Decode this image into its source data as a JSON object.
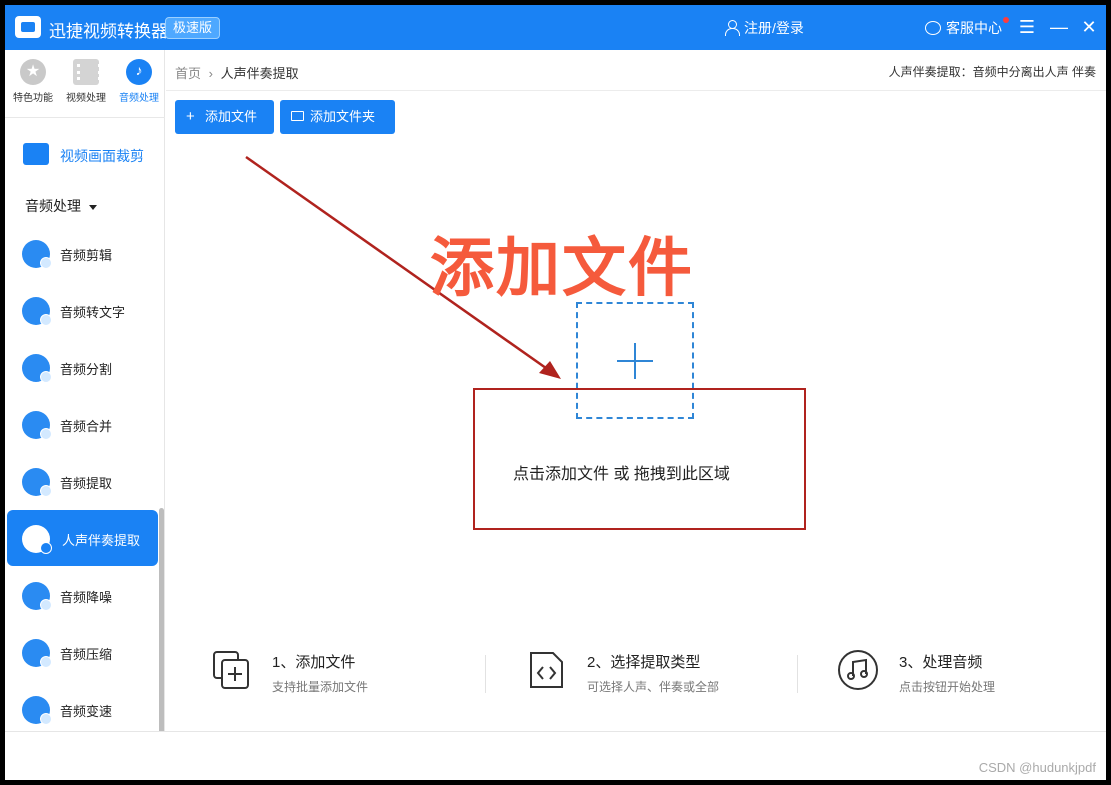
{
  "window": {
    "app_title": "迅捷视频转换器",
    "badge": "极速版",
    "login": "注册/登录",
    "service": "客服中心",
    "menu_glyph": "☰",
    "minimize_glyph": "—",
    "close_glyph": "✕"
  },
  "sidebar": {
    "tabs": [
      {
        "label": "特色功能",
        "icon": "star-icon"
      },
      {
        "label": "视频处理",
        "icon": "film-icon"
      },
      {
        "label": "音频处理",
        "icon": "audio-icon",
        "active": true
      }
    ],
    "crop_item": "视频画面裁剪",
    "section": "音频处理",
    "items": [
      {
        "label": "音频剪辑"
      },
      {
        "label": "音频转文字"
      },
      {
        "label": "音频分割"
      },
      {
        "label": "音频合并"
      },
      {
        "label": "音频提取"
      },
      {
        "label": "人声伴奏提取",
        "active": true
      },
      {
        "label": "音频降噪"
      },
      {
        "label": "音频压缩"
      },
      {
        "label": "音频变速"
      }
    ]
  },
  "breadcrumb": {
    "home": "首页",
    "separator": "›",
    "current": "人声伴奏提取"
  },
  "tip": "人声伴奏提取：音频中分离出人声 伴奏",
  "toolbar": {
    "add_file": "添加文件",
    "add_folder": "添加文件夹",
    "plus_glyph": "+"
  },
  "annotation": {
    "text": "添加文件",
    "color": "#f55a3c",
    "box_color": "#b0231e"
  },
  "dropzone": {
    "text": "点击添加文件 或 拖拽到此区域"
  },
  "steps": [
    {
      "title": "1、添加文件",
      "desc": "支持批量添加文件",
      "icon": "add-file-icon"
    },
    {
      "title": "2、选择提取类型",
      "desc": "可选择人声、伴奏或全部",
      "icon": "code-file-icon"
    },
    {
      "title": "3、处理音频",
      "desc": "点击按钮开始处理",
      "icon": "music-icon"
    }
  ],
  "watermark": "CSDN @hudunkjpdf",
  "colors": {
    "accent": "#1a82f4"
  }
}
